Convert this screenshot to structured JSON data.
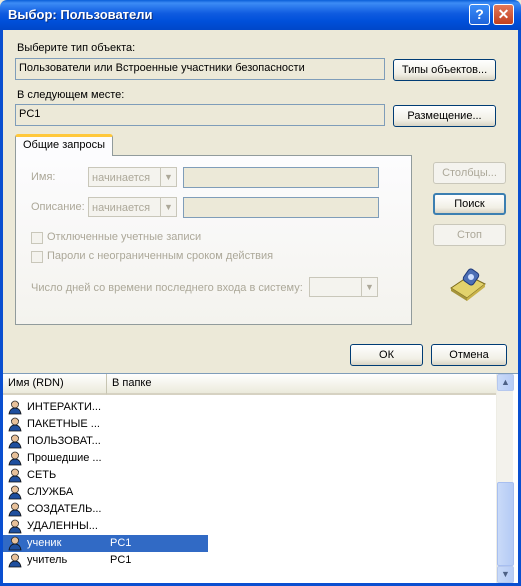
{
  "window": {
    "title": "Выбор: Пользователи",
    "help_glyph": "?",
    "close_glyph": "✕"
  },
  "object_type": {
    "label": "Выберите тип объекта:",
    "value": "Пользователи или Встроенные участники безопасности",
    "button": "Типы объектов..."
  },
  "location": {
    "label": "В следующем месте:",
    "value": "PC1",
    "button": "Размещение..."
  },
  "queries": {
    "tab": "Общие запросы",
    "name_label": "Имя:",
    "name_operator": "начинается",
    "description_label": "Описание:",
    "description_operator": "начинается",
    "disabled_accounts": "Отключенные учетные записи",
    "no_expire_passwords": "Пароли с неограниченным сроком действия",
    "days_since_login_label": "Число дней со времени последнего входа в систему:"
  },
  "side_buttons": {
    "columns": "Столбцы...",
    "search": "Поиск",
    "stop": "Стоп"
  },
  "footer": {
    "ok": "ОК",
    "cancel": "Отмена"
  },
  "results": {
    "columns": [
      "Имя (RDN)",
      "В папке"
    ],
    "rows": [
      {
        "name": "ИНТЕРАКТИ...",
        "folder": ""
      },
      {
        "name": "ПАКЕТНЫЕ ...",
        "folder": ""
      },
      {
        "name": "ПОЛЬЗОВАТ...",
        "folder": ""
      },
      {
        "name": "Прошедшие ...",
        "folder": ""
      },
      {
        "name": "СЕТЬ",
        "folder": ""
      },
      {
        "name": "СЛУЖБА",
        "folder": ""
      },
      {
        "name": "СОЗДАТЕЛЬ...",
        "folder": ""
      },
      {
        "name": "УДАЛЕННЫ...",
        "folder": ""
      },
      {
        "name": "ученик",
        "folder": "PC1",
        "selected": true
      },
      {
        "name": "учитель",
        "folder": "PC1"
      }
    ]
  },
  "icons": {
    "title_help": "help-icon",
    "title_close": "close-icon",
    "search_illustration": "search-flashlight-icon",
    "user": "user-icon",
    "scroll_up": "scroll-up-arrow-icon",
    "scroll_down": "scroll-down-arrow-icon"
  },
  "colors": {
    "title_bar": "#0050DA",
    "selection": "#316AC5",
    "dialog_bg": "#ECE9D8"
  }
}
